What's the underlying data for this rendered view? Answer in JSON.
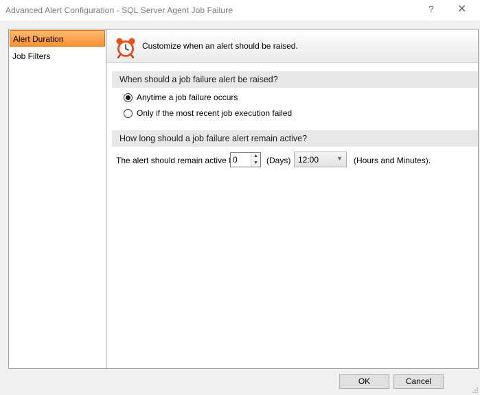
{
  "window": {
    "title": "Advanced Alert Configuration - SQL Server Agent Job Failure",
    "help_glyph": "?",
    "close_glyph": "✕"
  },
  "nav": {
    "items": [
      {
        "label": "Alert Duration",
        "active": true
      },
      {
        "label": "Job Filters",
        "active": false
      }
    ]
  },
  "header": {
    "icon": "alarm-clock-icon",
    "text": "Customize when an alert should be raised."
  },
  "raise_section": {
    "title": "When should a job failure alert be raised?",
    "options": [
      {
        "label": "Anytime a job failure occurs",
        "checked": true
      },
      {
        "label": "Only if the most recent job execution failed",
        "checked": false
      }
    ]
  },
  "active_section": {
    "title": "How long should a job failure alert remain active?",
    "prefix_label": "The alert should remain active for",
    "days_value": "0",
    "days_label": "(Days)",
    "time_value": "12:00",
    "suffix_label": "(Hours and Minutes)."
  },
  "buttons": {
    "ok": "OK",
    "cancel": "Cancel"
  },
  "colors": {
    "nav_active": "#fb9134",
    "section_bg": "#e8e8e8",
    "clock": "#e8501e"
  }
}
